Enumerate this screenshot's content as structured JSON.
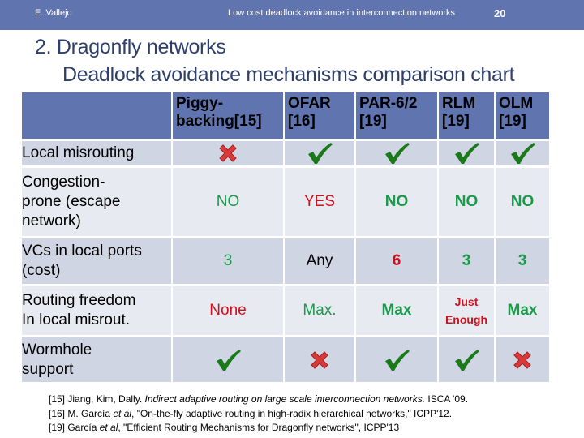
{
  "header": {
    "author": "E. Vallejo",
    "deck_title": "Low cost deadlock avoidance in interconnection networks",
    "page_number": "20"
  },
  "title": {
    "line1": "2. Dragonfly networks",
    "line2": "Deadlock avoidance mechanisms comparison chart"
  },
  "colors": {
    "header_bar": "#6074b0",
    "title_text": "#2f3f6b",
    "good": "#1a9a4a",
    "bad": "#d0101c",
    "check_icon": "#1a7a1a",
    "cross_icon": "#d83a3a"
  },
  "table": {
    "columns": [
      {
        "line1": "Piggy-",
        "line2": "backing[15]"
      },
      {
        "line1": "OFAR",
        "line2": "[16]"
      },
      {
        "line1": "PAR-6/2",
        "line2": "[19]"
      },
      {
        "line1": "RLM",
        "line2": "[19]"
      },
      {
        "line1": "OLM",
        "line2": "[19]"
      }
    ],
    "rows": [
      {
        "label": "Local misrouting",
        "cells": [
          {
            "type": "icon",
            "icon": "cross-icon"
          },
          {
            "type": "icon",
            "icon": "check-icon"
          },
          {
            "type": "icon",
            "icon": "check-icon"
          },
          {
            "type": "icon",
            "icon": "check-icon"
          },
          {
            "type": "icon",
            "icon": "check-icon"
          }
        ]
      },
      {
        "label_lines": [
          "Congestion-",
          "prone (escape",
          "network)"
        ],
        "cells": [
          {
            "type": "text",
            "text": "NO",
            "tone": "good"
          },
          {
            "type": "text",
            "text": "YES",
            "tone": "bad"
          },
          {
            "type": "text",
            "text": "NO",
            "tone": "good"
          },
          {
            "type": "text",
            "text": "NO",
            "tone": "good"
          },
          {
            "type": "text",
            "text": "NO",
            "tone": "good"
          }
        ]
      },
      {
        "label_lines": [
          "VCs in local ports",
          "(cost)"
        ],
        "cells": [
          {
            "type": "text",
            "text": "3",
            "tone": "good"
          },
          {
            "type": "text",
            "text": "Any",
            "tone": "neutral"
          },
          {
            "type": "text",
            "text": "6",
            "tone": "bad"
          },
          {
            "type": "text",
            "text": "3",
            "tone": "good"
          },
          {
            "type": "text",
            "text": "3",
            "tone": "good"
          }
        ]
      },
      {
        "label_lines": [
          "Routing freedom",
          "In local misrout."
        ],
        "cells": [
          {
            "type": "text",
            "text": "None",
            "tone": "bad"
          },
          {
            "type": "text",
            "text": "Max.",
            "tone": "good"
          },
          {
            "type": "text",
            "text": "Max",
            "tone": "good"
          },
          {
            "type": "text",
            "text_lines": [
              "Just",
              "Enough"
            ],
            "tone": "bad"
          },
          {
            "type": "text",
            "text": "Max",
            "tone": "good"
          }
        ]
      },
      {
        "label_lines": [
          "Wormhole",
          "support"
        ],
        "cells": [
          {
            "type": "icon",
            "icon": "check-icon"
          },
          {
            "type": "icon",
            "icon": "cross-icon"
          },
          {
            "type": "icon",
            "icon": "check-icon"
          },
          {
            "type": "icon",
            "icon": "check-icon"
          },
          {
            "type": "icon",
            "icon": "cross-icon"
          }
        ]
      }
    ]
  },
  "references": [
    {
      "prefix": "[15] Jiang, Kim, Dally. ",
      "italic": "Indirect adaptive routing on large scale interconnection networks.",
      "suffix": " ISCA '09."
    },
    {
      "prefix": "[16] M. García ",
      "italic": "et al",
      "suffix": ", \"On-the-fly adaptive routing in high-radix hierarchical networks,\" ICPP'12."
    },
    {
      "prefix": "[19] García ",
      "italic": "et al",
      "suffix": ", \"Efficient Routing Mechanisms for Dragonfly networks\", ICPP'13"
    }
  ]
}
